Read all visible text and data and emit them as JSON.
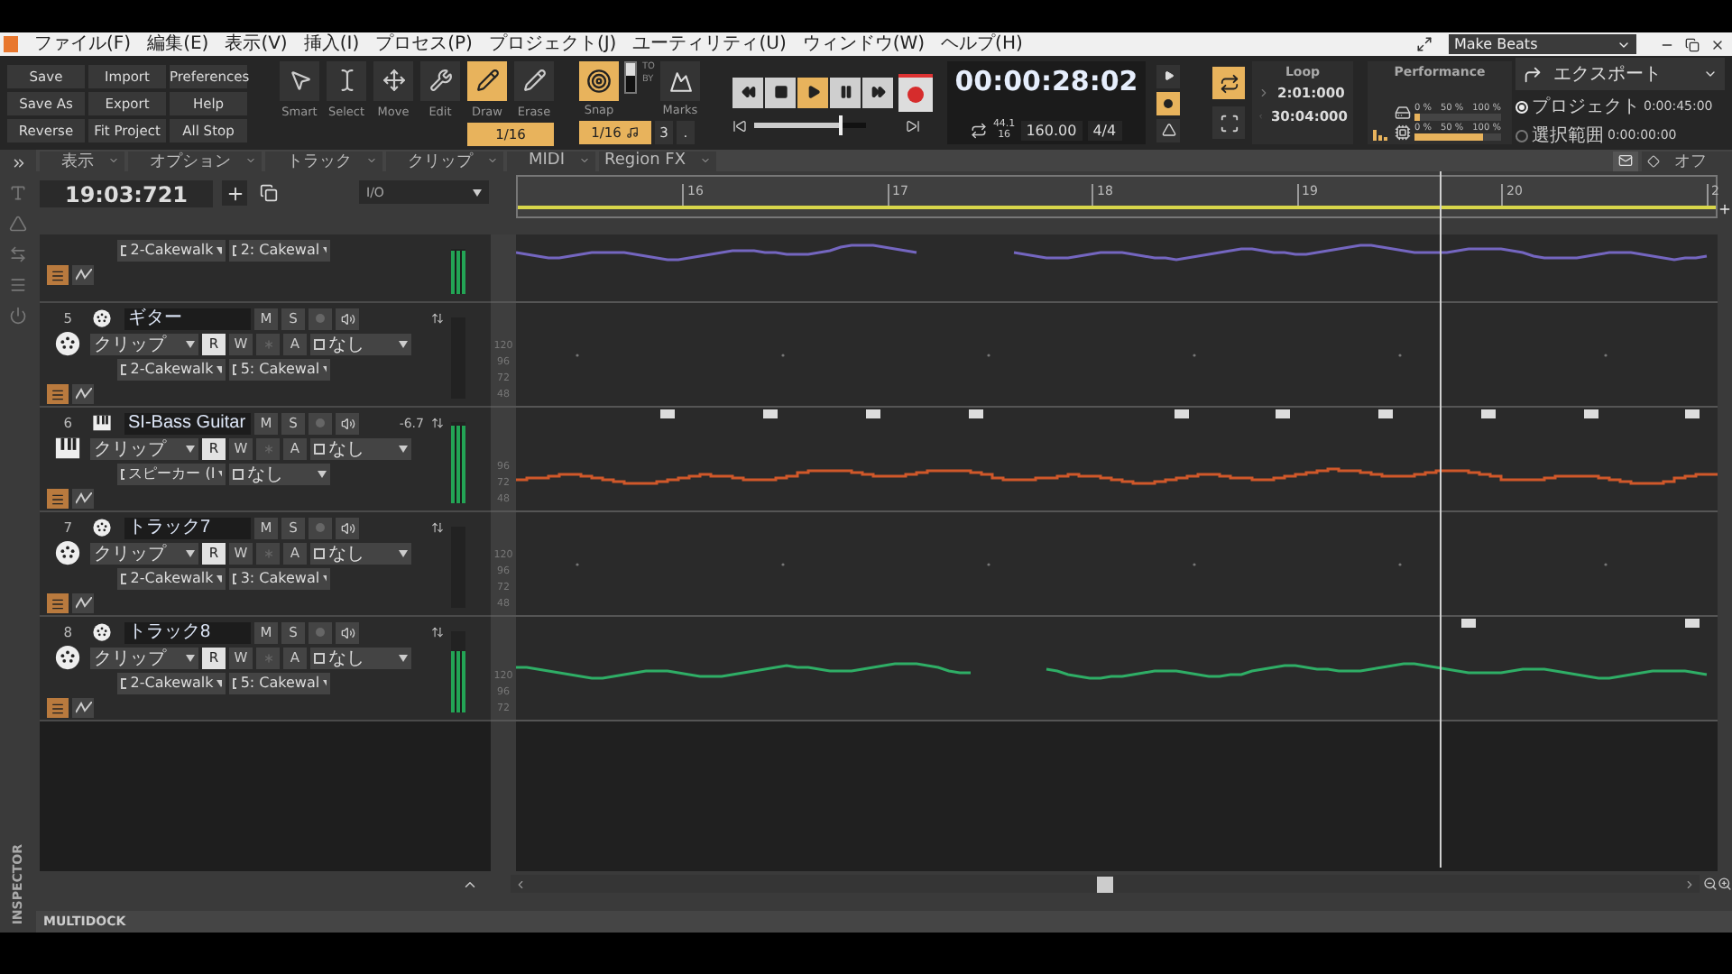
{
  "title_bar": {
    "menus": [
      "ファイル(F)",
      "編集(E)",
      "表示(V)",
      "挿入(I)",
      "プロセス(P)",
      "プロジェクト(J)",
      "ユーティリティ(U)",
      "ウィンドウ(W)",
      "ヘルプ(H)"
    ],
    "workspace": "Make Beats"
  },
  "control_bar": {
    "file_buttons": [
      "Save",
      "Import",
      "Preferences",
      "Save As",
      "Export",
      "Help",
      "Reverse",
      "Fit Project",
      "All Stop"
    ],
    "tools": [
      {
        "kind": "smart",
        "label": "Smart",
        "selected": false
      },
      {
        "kind": "select",
        "label": "Select",
        "selected": false
      },
      {
        "kind": "move",
        "label": "Move",
        "selected": false
      },
      {
        "kind": "edit",
        "label": "Edit",
        "selected": false
      },
      {
        "kind": "draw",
        "label": "Draw",
        "selected": true
      },
      {
        "kind": "erase",
        "label": "Erase",
        "selected": false
      }
    ],
    "tool_resolution": "1/16",
    "snap": {
      "label": "Snap",
      "on": true,
      "to_label": "TO",
      "by_label": "BY",
      "resolution": "1/16",
      "count": "3",
      "extra": ".",
      "marks_label": "Marks"
    },
    "transport": {
      "buttons": [
        {
          "kind": "rewind",
          "selected": false
        },
        {
          "kind": "stop",
          "selected": false
        },
        {
          "kind": "play",
          "selected": true
        },
        {
          "kind": "pause",
          "selected": false
        },
        {
          "kind": "forward",
          "selected": false
        }
      ],
      "position": {
        "level": 0.78
      }
    },
    "clock": {
      "time": "00:00:28:02",
      "sample_rate": "44.1",
      "bit_depth": "16",
      "tempo": "160.00",
      "meter": "4/4"
    },
    "record_mode": {
      "on": true
    },
    "loop": {
      "label": "Loop",
      "on": true,
      "start": "2:01:000",
      "end": "30:04:000"
    },
    "performance": {
      "title": "Performance",
      "meters": [
        {
          "kind": "disk",
          "ticks": [
            "0 %",
            "50 %",
            "100 %"
          ],
          "level": 0.06
        },
        {
          "kind": "cpu",
          "ticks": [
            "0 %",
            "50 %",
            "100 %"
          ],
          "level": 0.8
        }
      ]
    },
    "export": {
      "label": "エクスポート",
      "ranges": [
        {
          "label": "プロジェクト",
          "value": "0:00:45:00",
          "selected": true
        },
        {
          "label": "選択範囲",
          "value": "0:00:00:00",
          "selected": false
        }
      ]
    }
  },
  "track_view": {
    "menus": [
      "表示",
      "オプション",
      "トラック",
      "クリップ",
      "MIDI",
      "Region FX"
    ],
    "now_time": "19:03:721",
    "io_label": "I/O",
    "snap_label": "オフ",
    "ruler": [
      "16",
      "17",
      "18",
      "19",
      "20",
      "2"
    ],
    "tracks": [
      {
        "kind": "partial",
        "output": "2-Cakewalk",
        "channel": "2: Cakewal",
        "color": "#7466c0",
        "level": 0.95
      },
      {
        "kind": "midi",
        "number": "5",
        "name": "ギター",
        "input": "クリップ",
        "buttons": [
          {
            "label": "M",
            "on": false
          },
          {
            "label": "S",
            "on": false
          }
        ],
        "modes": [
          {
            "label": "R",
            "on": true
          },
          {
            "label": "W",
            "on": false
          },
          {
            "label": "A",
            "on": false
          }
        ],
        "automation": "なし",
        "output": "2-Cakewalk",
        "channel": "5: Cakewal",
        "scale": [
          "120",
          "96",
          "72",
          "48"
        ],
        "level": 0
      },
      {
        "kind": "instrument",
        "number": "6",
        "name": "SI-Bass Guitar",
        "volume": "-6.7",
        "input": "クリップ",
        "buttons": [
          {
            "label": "M",
            "on": false
          },
          {
            "label": "S",
            "on": false
          }
        ],
        "modes": [
          {
            "label": "R",
            "on": true
          },
          {
            "label": "W",
            "on": false
          },
          {
            "label": "A",
            "on": false
          }
        ],
        "automation": "なし",
        "output": "スピーカー (I",
        "channel": "なし",
        "scale": [
          "96",
          "72",
          "48"
        ],
        "color": "#d0582a",
        "level": 0.95
      },
      {
        "kind": "midi",
        "number": "7",
        "name": "トラック7",
        "input": "クリップ",
        "buttons": [
          {
            "label": "M",
            "on": false
          },
          {
            "label": "S",
            "on": false
          }
        ],
        "modes": [
          {
            "label": "R",
            "on": true
          },
          {
            "label": "W",
            "on": false
          },
          {
            "label": "A",
            "on": false
          }
        ],
        "automation": "なし",
        "output": "2-Cakewalk",
        "channel": "3: Cakewal",
        "scale": [
          "120",
          "96",
          "72",
          "48"
        ],
        "level": 0
      },
      {
        "kind": "midi",
        "number": "8",
        "name": "トラック8",
        "input": "クリップ",
        "buttons": [
          {
            "label": "M",
            "on": false
          },
          {
            "label": "S",
            "on": false
          }
        ],
        "modes": [
          {
            "label": "R",
            "on": true
          },
          {
            "label": "W",
            "on": false
          },
          {
            "label": "A",
            "on": false
          }
        ],
        "automation": "なし",
        "output": "2-Cakewalk",
        "channel": "5: Cakewal",
        "scale": [
          "120",
          "96",
          "72"
        ],
        "color": "#2fae66",
        "level": 0.75
      }
    ],
    "inspector_label": "INSPECTOR",
    "multidock_label": "MULTIDOCK"
  }
}
